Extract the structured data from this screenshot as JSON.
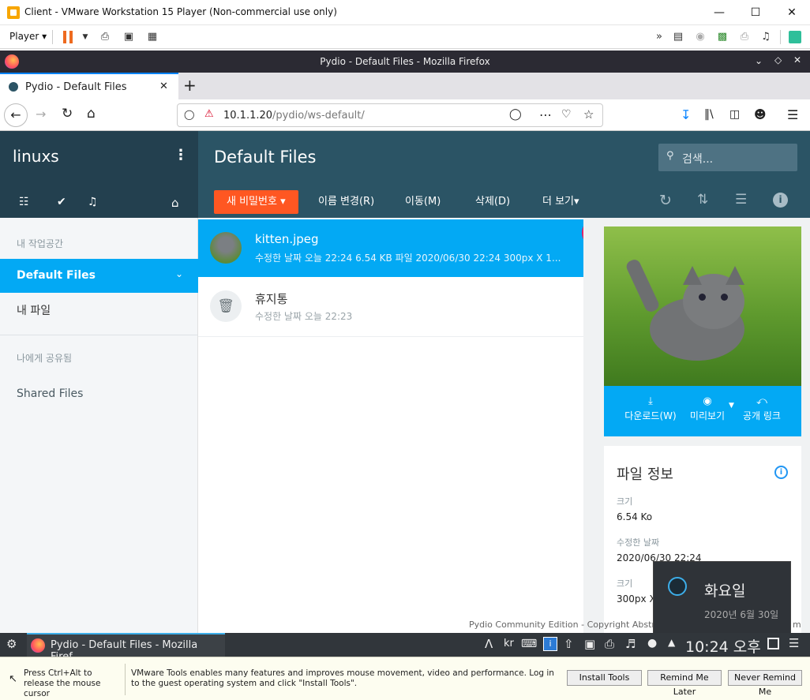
{
  "vmware": {
    "title": "Client - VMware Workstation 15 Player (Non-commercial use only)",
    "player_menu": "Player",
    "hint_text": "Press Ctrl+Alt to release the mouse cursor",
    "tools_message": "VMware Tools enables many features and improves mouse movement, video and performance. Log in to the guest operating system and click \"Install Tools\".",
    "install_tools": "Install Tools",
    "remind_later": "Remind Me Later",
    "never_remind": "Never Remind Me"
  },
  "firefox": {
    "window_title": "Pydio - Default Files - Mozilla Firefox",
    "tab_title": "Pydio - Default Files",
    "url_host": "10.1.1.20",
    "url_path": "/pydio/ws-default/"
  },
  "pydio": {
    "user": "linuxs",
    "page_title": "Default Files",
    "search_placeholder": "검색...",
    "sidebar": {
      "section_my_workspaces": "내 작업공간",
      "items": [
        {
          "label": "Default Files",
          "active": true
        },
        {
          "label": "내 파일",
          "active": false
        }
      ],
      "section_shared": "나에게 공유됨",
      "shared_items": [
        {
          "label": "Shared Files"
        }
      ]
    },
    "toolbar": {
      "new_password": "새 비밀번호",
      "rename": "이름 변경(R)",
      "move": "이동(M)",
      "delete": "삭제(D)",
      "more": "더 보기"
    },
    "files": [
      {
        "name": "kitten.jpeg",
        "meta": "수정한 날짜 오늘 22:24  6.54 KB  파일  2020/06/30 22:24  300px X 1...",
        "selected": true
      },
      {
        "name": "휴지통",
        "meta": "수정한 날짜 오늘 22:23",
        "selected": false
      }
    ],
    "preview_actions": {
      "download": "다운로드(W)",
      "preview": "미리보기",
      "public_link": "공개 링크"
    },
    "file_info": {
      "title": "파일 정보",
      "size_label": "크기",
      "size_value": "6.54 Ko",
      "modified_label": "수정한 날짜",
      "modified_value": "2020/06/30 22:24",
      "dims_label": "크기",
      "dims_value": "300px X"
    },
    "footer": "Pydio Community Edition - Copyright Abstrium",
    "footer_tail": "m"
  },
  "taskbar": {
    "window_label": "Pydio - Default Files - Mozilla Firef...",
    "lang": "kr",
    "clock": "10:24 오후"
  },
  "calendar_popup": {
    "day": "화요일",
    "date": "2020년 6월 30일"
  },
  "colors": {
    "sidebar_dark": "#23404f",
    "header": "#2b5465",
    "accent_orange": "#ff5722",
    "selected_row": "#03a9f4"
  }
}
